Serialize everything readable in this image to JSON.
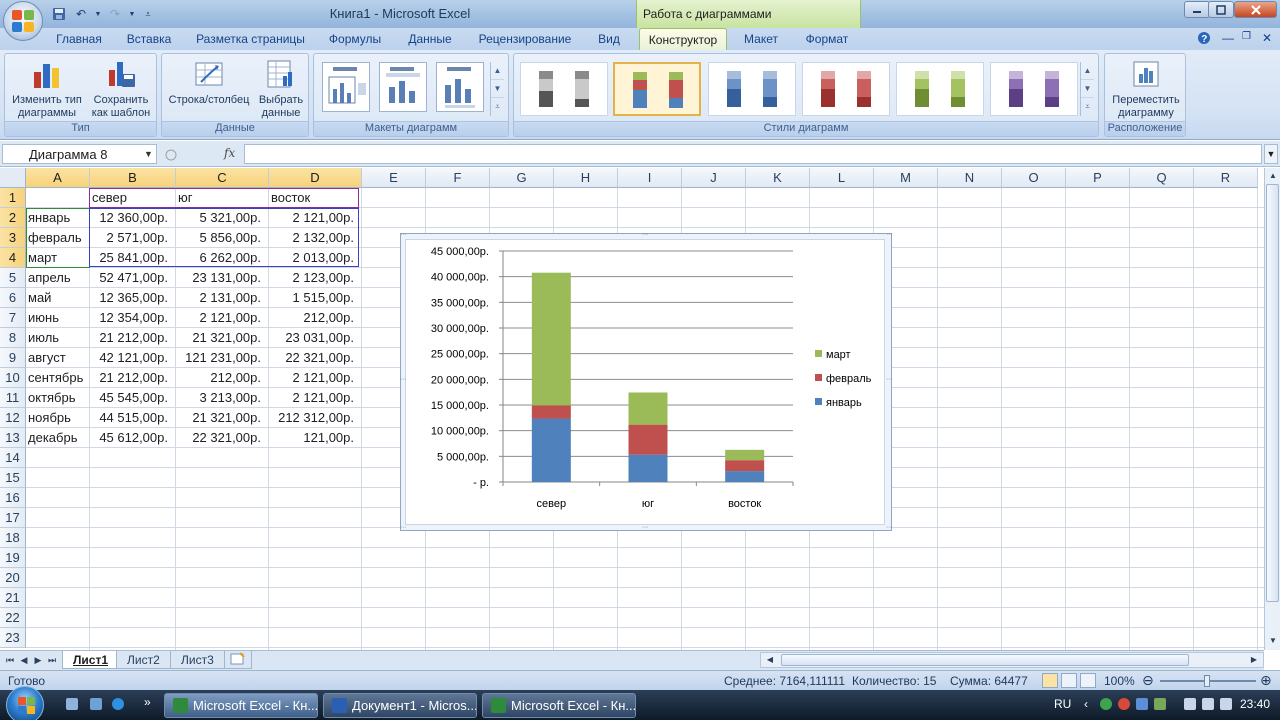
{
  "window": {
    "title": "Книга1 - Microsoft Excel",
    "context_tab_title": "Работа с диаграммами"
  },
  "ribbon_tabs": [
    "Главная",
    "Вставка",
    "Разметка страницы",
    "Формулы",
    "Данные",
    "Рецензирование",
    "Вид",
    "Конструктор",
    "Макет",
    "Формат"
  ],
  "active_tab": "Конструктор",
  "ribbon": {
    "type_group": {
      "label": "Тип",
      "change_type": "Изменить тип\nдиаграммы",
      "save_template": "Сохранить\nкак шаблон"
    },
    "data_group": {
      "label": "Данные",
      "switch_row_col": "Строка/столбец",
      "select_data": "Выбрать\nданные"
    },
    "layouts_group": {
      "label": "Макеты диаграмм"
    },
    "styles_group": {
      "label": "Стили диаграмм"
    },
    "location_group": {
      "label": "Расположение",
      "move_chart": "Переместить\nдиаграмму"
    }
  },
  "formula_bar": {
    "name_box": "Диаграмма 8",
    "fx": "fx",
    "formula": ""
  },
  "columns": [
    "A",
    "B",
    "C",
    "D",
    "E",
    "F",
    "G",
    "H",
    "I",
    "J",
    "K",
    "L",
    "M",
    "N",
    "O",
    "P",
    "Q",
    "R"
  ],
  "rows": [
    "1",
    "2",
    "3",
    "4",
    "5",
    "6",
    "7",
    "8",
    "9",
    "10",
    "11",
    "12",
    "13",
    "14",
    "15",
    "16",
    "17",
    "18",
    "19",
    "20",
    "21",
    "22",
    "23"
  ],
  "sheet": {
    "header": [
      "",
      "север",
      "юг",
      "восток"
    ],
    "data": [
      [
        "январь",
        "12 360,00р.",
        "5 321,00р.",
        "2 121,00р."
      ],
      [
        "февраль",
        "2 571,00р.",
        "5 856,00р.",
        "2 132,00р."
      ],
      [
        "март",
        "25 841,00р.",
        "6 262,00р.",
        "2 013,00р."
      ],
      [
        "апрель",
        "52 471,00р.",
        "23 131,00р.",
        "2 123,00р."
      ],
      [
        "май",
        "12 365,00р.",
        "2 131,00р.",
        "1 515,00р."
      ],
      [
        "июнь",
        "12 354,00р.",
        "2 121,00р.",
        "212,00р."
      ],
      [
        "июль",
        "21 212,00р.",
        "21 321,00р.",
        "23 031,00р."
      ],
      [
        "август",
        "42 121,00р.",
        "121 231,00р.",
        "22 321,00р."
      ],
      [
        "сентябрь",
        "21 212,00р.",
        "212,00р.",
        "2 121,00р."
      ],
      [
        "октябрь",
        "45 545,00р.",
        "3 213,00р.",
        "2 121,00р."
      ],
      [
        "ноябрь",
        "44 515,00р.",
        "21 321,00р.",
        "212 312,00р."
      ],
      [
        "декабрь",
        "45 612,00р.",
        "22 321,00р.",
        "121,00р."
      ]
    ]
  },
  "chart_data": {
    "type": "bar",
    "stacked": true,
    "categories": [
      "север",
      "юг",
      "восток"
    ],
    "series": [
      {
        "name": "январь",
        "values": [
          12360,
          5321,
          2121
        ],
        "color": "#4f81bd"
      },
      {
        "name": "февраль",
        "values": [
          2571,
          5856,
          2132
        ],
        "color": "#c0504d"
      },
      {
        "name": "март",
        "values": [
          25841,
          6262,
          2013
        ],
        "color": "#9bbb59"
      }
    ],
    "ylim": [
      0,
      45000
    ],
    "yticks": [
      "-  р.",
      "5 000,00р.",
      "10 000,00р.",
      "15 000,00р.",
      "20 000,00р.",
      "25 000,00р.",
      "30 000,00р.",
      "35 000,00р.",
      "40 000,00р.",
      "45 000,00р."
    ],
    "legend_order": [
      "март",
      "февраль",
      "январь"
    ],
    "legend_position": "right",
    "grid": true
  },
  "sheet_tabs": [
    "Лист1",
    "Лист2",
    "Лист3"
  ],
  "active_sheet": "Лист1",
  "status": {
    "ready": "Готово",
    "average": "Среднее: 7164,111111",
    "count": "Количество: 15",
    "sum": "Сумма: 64477",
    "zoom": "100%"
  },
  "taskbar": {
    "tasks": [
      "Microsoft Excel - Кн...",
      "Документ1 - Micros...",
      "Microsoft Excel - Кн..."
    ],
    "language": "RU",
    "time": "23:40"
  },
  "colors": {
    "ribbon_bg": "#dbe7f6",
    "context_green": "#c8e3a1",
    "selection": "#f8d27a"
  }
}
